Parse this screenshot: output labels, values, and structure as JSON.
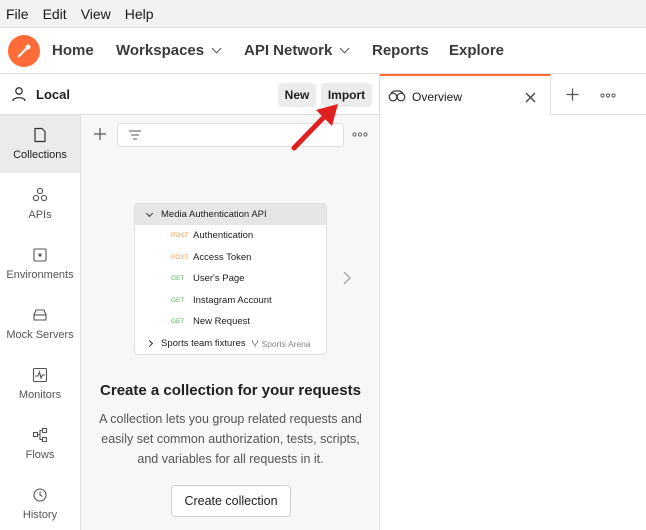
{
  "menu": [
    "File",
    "Edit",
    "View",
    "Help"
  ],
  "nav": {
    "home": "Home",
    "workspaces": "Workspaces",
    "api_network": "API Network",
    "reports": "Reports",
    "explore": "Explore"
  },
  "workspace": {
    "name": "Local",
    "new_label": "New",
    "import_label": "Import"
  },
  "rail": [
    {
      "label": "Collections",
      "icon": "collections-icon",
      "active": true
    },
    {
      "label": "APIs",
      "icon": "apis-icon"
    },
    {
      "label": "Environments",
      "icon": "environments-icon"
    },
    {
      "label": "Mock Servers",
      "icon": "mock-servers-icon"
    },
    {
      "label": "Monitors",
      "icon": "monitors-icon"
    },
    {
      "label": "Flows",
      "icon": "flows-icon"
    },
    {
      "label": "History",
      "icon": "history-icon"
    }
  ],
  "preview": {
    "collection": "Media Authentication API",
    "requests": [
      {
        "method": "POST",
        "name": "Authentication"
      },
      {
        "method": "POST",
        "name": "Access Token"
      },
      {
        "method": "GET",
        "name": "User's Page"
      },
      {
        "method": "GET",
        "name": "Instagram Account"
      },
      {
        "method": "GET",
        "name": "New Request"
      }
    ],
    "footer_collection": "Sports team fixtures",
    "footer_workspace": "Sports Arena"
  },
  "empty_state": {
    "title": "Create a collection for your requests",
    "description": "A collection lets you group related requests and easily set common authorization, tests, scripts, and variables for all requests in it.",
    "button": "Create collection"
  },
  "tabs": {
    "overview": "Overview"
  },
  "colors": {
    "accent": "#ff6c37",
    "arrow": "#e02020",
    "post": "#f0a050",
    "get": "#5cb85c"
  }
}
